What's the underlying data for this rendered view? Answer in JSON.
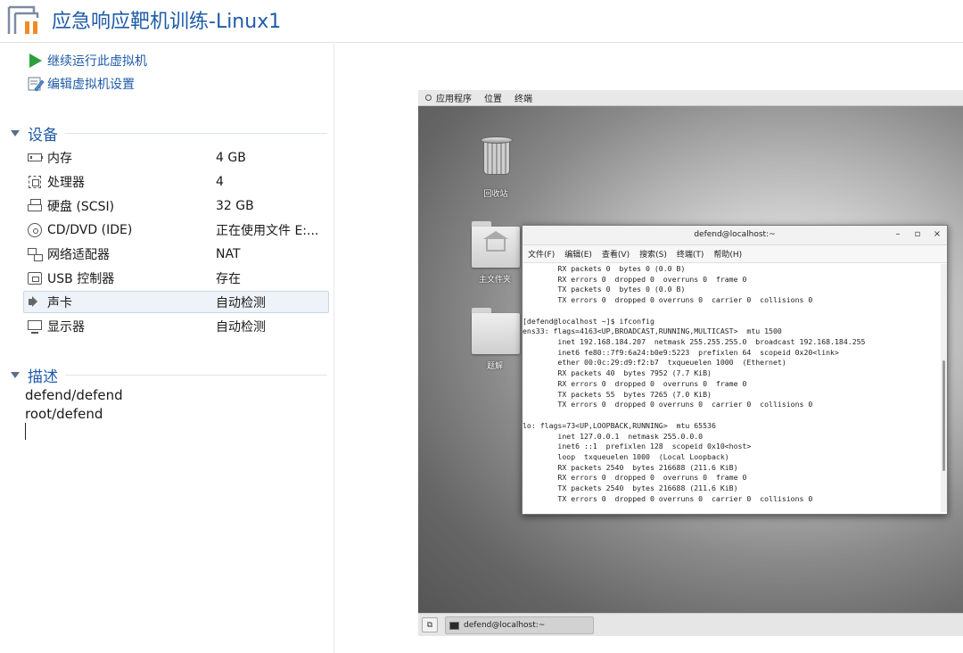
{
  "window": {
    "title": "应急响应靶机训练-Linux1"
  },
  "actions": [
    {
      "label": "继续运行此虚拟机",
      "icon": "play-icon"
    },
    {
      "label": "编辑虚拟机设置",
      "icon": "edit-settings-icon"
    }
  ],
  "devices": {
    "heading": "设备",
    "items": [
      {
        "name": "内存",
        "value": "4 GB",
        "icon": "memory-icon"
      },
      {
        "name": "处理器",
        "value": "4",
        "icon": "processor-icon"
      },
      {
        "name": "硬盘 (SCSI)",
        "value": "32 GB",
        "icon": "hard-disk-icon"
      },
      {
        "name": "CD/DVD (IDE)",
        "value": "正在使用文件 E:...",
        "icon": "cd-dvd-icon"
      },
      {
        "name": "网络适配器",
        "value": "NAT",
        "icon": "network-adapter-icon"
      },
      {
        "name": "USB 控制器",
        "value": "存在",
        "icon": "usb-controller-icon"
      },
      {
        "name": "声卡",
        "value": "自动检测",
        "icon": "sound-card-icon",
        "selected": true
      },
      {
        "name": "显示器",
        "value": "自动检测",
        "icon": "display-icon"
      }
    ]
  },
  "description": {
    "heading": "描述",
    "lines": [
      "defend/defend",
      "root/defend"
    ]
  },
  "vm": {
    "topbar": {
      "applications": "应用程序",
      "places": "位置",
      "terminal": "终端"
    },
    "desktop_icons": [
      {
        "label": "回收站",
        "icon": "trash-icon"
      },
      {
        "label": "主文件夹",
        "icon": "home-folder-icon"
      },
      {
        "label": "题解",
        "icon": "folder-icon"
      }
    ],
    "terminal": {
      "title": "defend@localhost:~",
      "buttons": {
        "minimize": "–",
        "maximize": "▫",
        "close": "×"
      },
      "menu": [
        "文件(F)",
        "编辑(E)",
        "查看(V)",
        "搜索(S)",
        "终端(T)",
        "帮助(H)"
      ],
      "lines": [
        "        RX packets 0  bytes 0 (0.0 B)",
        "        RX errors 0  dropped 0  overruns 0  frame 0",
        "        TX packets 0  bytes 0 (0.0 B)",
        "        TX errors 0  dropped 0 overruns 0  carrier 0  collisions 0",
        "",
        "[defend@localhost ~]$ ifconfig",
        "ens33: flags=4163<UP,BROADCAST,RUNNING,MULTICAST>  mtu 1500",
        "        inet 192.168.184.207  netmask 255.255.255.0  broadcast 192.168.184.255",
        "        inet6 fe80::7f9:6a24:b0e9:5223  prefixlen 64  scopeid 0x20<link>",
        "        ether 00:0c:29:d9:f2:b7  txqueuelen 1000  (Ethernet)",
        "        RX packets 40  bytes 7952 (7.7 KiB)",
        "        RX errors 0  dropped 0  overruns 0  frame 0",
        "        TX packets 55  bytes 7265 (7.0 KiB)",
        "        TX errors 0  dropped 0 overruns 0  carrier 0  collisions 0",
        "",
        "lo: flags=73<UP,LOOPBACK,RUNNING>  mtu 65536",
        "        inet 127.0.0.1  netmask 255.0.0.0",
        "        inet6 ::1  prefixlen 128  scopeid 0x10<host>",
        "        loop  txqueuelen 1000  (Local Loopback)",
        "        RX packets 2540  bytes 216688 (211.6 KiB)",
        "        RX errors 0  dropped 0  overruns 0  frame 0",
        "        TX packets 2540  bytes 216688 (211.6 KiB)",
        "        TX errors 0  dropped 0 overruns 0  carrier 0  collisions 0"
      ]
    },
    "taskbar": {
      "task_label": "defend@localhost:~",
      "show_desktop_icon": "show-desktop-icon"
    }
  },
  "colors": {
    "accent": "#1f5ba8",
    "play": "#2e9e3a",
    "selected_row": "#eef3f9"
  }
}
